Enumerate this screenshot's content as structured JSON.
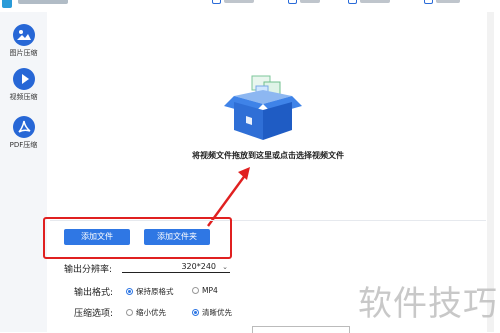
{
  "sidebar": {
    "items": [
      {
        "label": "图片压缩",
        "icon": "image-icon"
      },
      {
        "label": "视频压缩",
        "icon": "play-icon"
      },
      {
        "label": "PDF压缩",
        "icon": "pdf-icon"
      }
    ]
  },
  "dropzone": {
    "hint": "将视频文件拖放到这里或点击选择视频文件"
  },
  "actions": {
    "add_file": "添加文件",
    "add_folder": "添加文件夹"
  },
  "settings": {
    "resolution_label": "输出分辨率:",
    "resolution_value": "320*240",
    "format_label": "输出格式:",
    "format_options": [
      "保持原格式",
      "MP4"
    ],
    "format_selected": "保持原格式",
    "compress_label": "压缩选项:",
    "compress_options": [
      "缩小优先",
      "清晰优先"
    ],
    "compress_selected": "清晰优先"
  },
  "watermark": "软件技巧",
  "colors": {
    "accent": "#2f77e4",
    "highlight": "#e02020"
  }
}
